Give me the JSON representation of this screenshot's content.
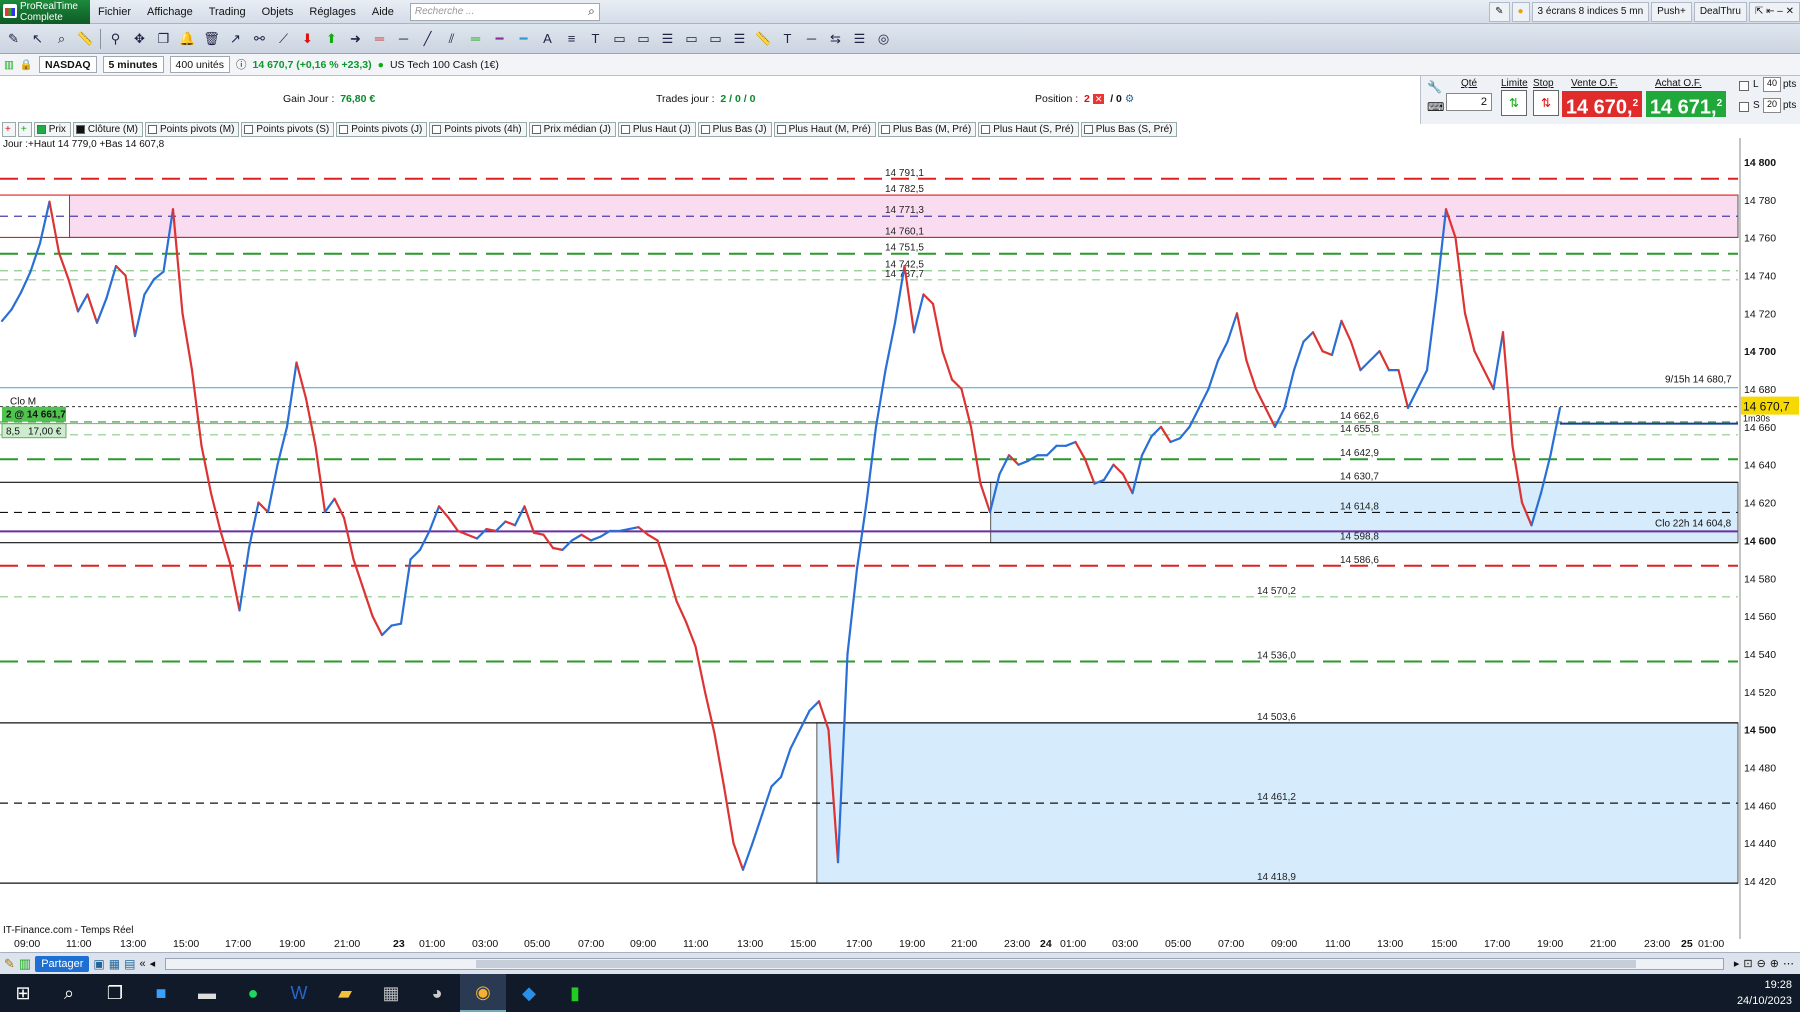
{
  "app": {
    "logo_line1": "ProRealTime",
    "logo_line2": "Complete"
  },
  "menu": [
    "Fichier",
    "Affichage",
    "Trading",
    "Objets",
    "Réglages",
    "Aide"
  ],
  "search_placeholder": "Recherche ...",
  "right_menu": {
    "screens": "3 écrans 8 indices 5 mn",
    "push": "Push+",
    "dealthru": "DealThru"
  },
  "instrument": {
    "market": "NASDAQ",
    "timeframe": "5 minutes",
    "units": "400 unités",
    "quote": "14 670,7 (+0,16 % +23,3)",
    "name": "US Tech 100 Cash (1€)"
  },
  "stats": {
    "gain_label": "Gain Jour :",
    "gain_value": "76,80 €",
    "trades_label": "Trades jour :",
    "trades_value": "2 / 0 / 0",
    "position_label": "Position :",
    "position_value": "2",
    "position_extra": "/ 0"
  },
  "order_panel": {
    "qty_label": "Qté",
    "qty_value": "2",
    "limit_label": "Limite",
    "stop_label": "Stop",
    "sell_label": "Vente O.F.",
    "buy_label": "Achat O.F.",
    "sell_price": "14 670,",
    "sell_price_sup": "2",
    "buy_price": "14 671,",
    "buy_price_sup": "2",
    "l_label": "L",
    "l_value": "40",
    "s_label": "S",
    "s_value": "20",
    "pts": "pts"
  },
  "indicators": [
    "Prix",
    "Clôture (M)",
    "Points pivots (M)",
    "Points pivots (S)",
    "Points pivots (J)",
    "Points pivots (4h)",
    "Prix médian (J)",
    "Plus Haut (J)",
    "Plus Bas (J)",
    "Plus Haut (M, Pré)",
    "Plus Bas (M, Pré)",
    "Plus Haut (S, Pré)",
    "Plus Bas (S, Pré)"
  ],
  "chart_data": {
    "type": "line",
    "info_text": "Jour :+Haut 14 779,0 +Bas 14 607,8",
    "source": "IT-Finance.com - Temps Réel",
    "ylim": [
      14410,
      14810
    ],
    "y_ticks": [
      "14 800",
      "14 780",
      "14 760",
      "14 740",
      "14 720",
      "14 700",
      "14 680",
      "14 660",
      "14 640",
      "14 620",
      "14 600",
      "14 580",
      "14 560",
      "14 540",
      "14 520",
      "14 500",
      "14 480",
      "14 460",
      "14 440",
      "14 420"
    ],
    "y_tick_values": [
      14800,
      14780,
      14760,
      14740,
      14720,
      14700,
      14680,
      14660,
      14640,
      14620,
      14600,
      14580,
      14560,
      14540,
      14520,
      14500,
      14480,
      14460,
      14440,
      14420
    ],
    "x_ticks": [
      "09:00",
      "11:00",
      "13:00",
      "15:00",
      "17:00",
      "19:00",
      "21:00",
      "23",
      "01:00",
      "03:00",
      "05:00",
      "07:00",
      "09:00",
      "11:00",
      "13:00",
      "15:00",
      "17:00",
      "19:00",
      "21:00",
      "23:00",
      "24",
      "01:00",
      "03:00",
      "05:00",
      "07:00",
      "09:00",
      "11:00",
      "13:00",
      "15:00",
      "17:00",
      "19:00",
      "21:00",
      "23:00",
      "25",
      "01:00"
    ],
    "levels": [
      {
        "label": "14 791,1",
        "value": 14791.1,
        "color": "#e02020",
        "dash": "long",
        "from": 0
      },
      {
        "label": "14 782,5",
        "value": 14782.5,
        "color": "#e02020",
        "dash": "none",
        "from": 0
      },
      {
        "label": "14 771,3",
        "value": 14771.3,
        "color": "#4a3fb0",
        "dash": "short",
        "from": 0
      },
      {
        "label": "14 760,1",
        "value": 14760.1,
        "color": "#e02020",
        "dash": "none",
        "from": 0
      },
      {
        "label": "14 751,5",
        "value": 14751.5,
        "color": "#2a9a2a",
        "dash": "long",
        "from": 0
      },
      {
        "label": "14 742,5",
        "value": 14742.5,
        "color": "#8acb8a",
        "dash": "short",
        "from": 0
      },
      {
        "label": "14 737,7",
        "value": 14737.7,
        "color": "#8acb8a",
        "dash": "short",
        "from": 0
      },
      {
        "label": "14 662,6",
        "value": 14662.6,
        "color": "#2a9a2a",
        "dash": "short",
        "from": 0
      },
      {
        "label": "14 655,8",
        "value": 14655.8,
        "color": "#8acb8a",
        "dash": "short",
        "from": 0
      },
      {
        "label": "14 642,9",
        "value": 14642.9,
        "color": "#2a9a2a",
        "dash": "long",
        "from": 0
      },
      {
        "label": "14 630,7",
        "value": 14630.7,
        "color": "#111111",
        "dash": "none",
        "from": 0
      },
      {
        "label": "14 614,8",
        "value": 14614.8,
        "color": "#111111",
        "dash": "short",
        "from": 0
      },
      {
        "label": "14 598,8",
        "value": 14598.8,
        "color": "#111111",
        "dash": "none",
        "from": 0
      },
      {
        "label": "14 586,6",
        "value": 14586.6,
        "color": "#e02020",
        "dash": "long",
        "from": 0
      },
      {
        "label": "14 570,2",
        "value": 14570.2,
        "color": "#8acb8a",
        "dash": "short",
        "from": 0
      },
      {
        "label": "14 536,0",
        "value": 14536.0,
        "color": "#2a9a2a",
        "dash": "long",
        "from": 0
      },
      {
        "label": "14 503,6",
        "value": 14503.6,
        "color": "#111111",
        "dash": "none",
        "from": 0
      },
      {
        "label": "14 461,2",
        "value": 14461.2,
        "color": "#111111",
        "dash": "short",
        "from": 0
      },
      {
        "label": "14 418,9",
        "value": 14418.9,
        "color": "#111111",
        "dash": "none",
        "from": 0
      }
    ],
    "annotations": {
      "clo_m": "Clo M",
      "position_tag": "2 @ 14 661,7",
      "pnl_pts": "8,5",
      "pnl_eur": "17,00 €",
      "h15": "9/15h 14 680,7",
      "clo22": "Clo 22h 14 604,8",
      "last_price": "14 670,7",
      "countdown": "1m30s"
    },
    "series": [
      {
        "name": "Prix",
        "values": [
          14716,
          14722,
          14731,
          14742,
          14757,
          14779,
          14752,
          14738,
          14721,
          14730,
          14715,
          14728,
          14745,
          14740,
          14708,
          14730,
          14738,
          14742,
          14775,
          14720,
          14690,
          14650,
          14625,
          14605,
          14588,
          14563,
          14596,
          14620,
          14615,
          14640,
          14660,
          14694,
          14675,
          14650,
          14615,
          14622,
          14612,
          14590,
          14575,
          14560,
          14550,
          14555,
          14556,
          14590,
          14595,
          14605,
          14618,
          14612,
          14605,
          14603,
          14601,
          14606,
          14605,
          14610,
          14608,
          14618,
          14604,
          14603,
          14596,
          14595,
          14600,
          14603,
          14600,
          14602,
          14605,
          14605,
          14606,
          14607,
          14603,
          14600,
          14585,
          14568,
          14557,
          14544,
          14520,
          14498,
          14470,
          14440,
          14426,
          14440,
          14455,
          14470,
          14475,
          14490,
          14500,
          14510,
          14515,
          14500,
          14430,
          14540,
          14585,
          14620,
          14660,
          14690,
          14715,
          14745,
          14710,
          14730,
          14725,
          14700,
          14685,
          14680,
          14660,
          14630,
          14615,
          14635,
          14645,
          14640,
          14642,
          14645,
          14645,
          14650,
          14650,
          14652,
          14643,
          14630,
          14632,
          14640,
          14635,
          14625,
          14645,
          14655,
          14660,
          14652,
          14654,
          14660,
          14670,
          14680,
          14695,
          14705,
          14720,
          14695,
          14680,
          14670,
          14660,
          14670,
          14690,
          14705,
          14710,
          14700,
          14698,
          14716,
          14705,
          14690,
          14695,
          14700,
          14690,
          14690,
          14670,
          14680,
          14690,
          14730,
          14775,
          14760,
          14720,
          14700,
          14690,
          14680,
          14710,
          14650,
          14620,
          14608,
          14625,
          14645,
          14670
        ]
      }
    ]
  },
  "zones": [
    {
      "name": "weekly-range-top",
      "top": 14782.5,
      "bottom": 14760.1,
      "color": "#fadcf0",
      "from_x": 0.04
    },
    {
      "name": "zone-mid",
      "top": 14630.7,
      "bottom": 14598.8,
      "color": "#d6ebfb",
      "from_x": 0.57
    },
    {
      "name": "zone-low",
      "top": 14503.6,
      "bottom": 14418.9,
      "color": "#d6ebfb",
      "from_x": 0.47
    }
  ],
  "ref_lines": {
    "hline1": 14680.7,
    "hline2": 14670.7,
    "hline3": 14661.7,
    "purple": 14604.8
  },
  "bottom": {
    "share_label": "Partager"
  },
  "taskbar": {
    "time": "19:28",
    "date": "24/10/2023"
  }
}
